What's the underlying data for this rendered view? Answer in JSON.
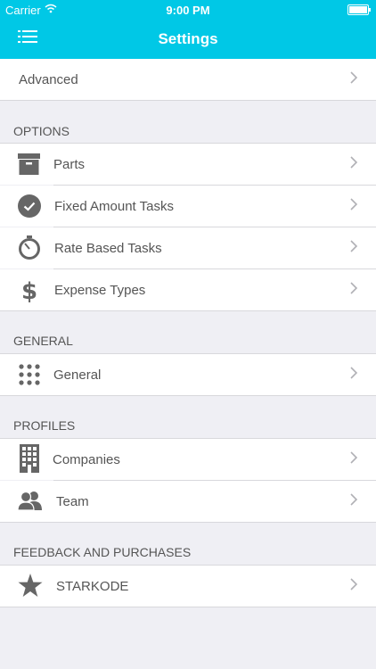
{
  "status_bar": {
    "carrier": "Carrier",
    "time": "9:00 PM"
  },
  "nav": {
    "title": "Settings"
  },
  "advanced": {
    "label": "Advanced"
  },
  "sections": {
    "options": {
      "header": "OPTIONS",
      "items": [
        {
          "label": "Parts",
          "icon": "archive-box-icon"
        },
        {
          "label": "Fixed Amount Tasks",
          "icon": "checkmark-circle-icon"
        },
        {
          "label": "Rate Based Tasks",
          "icon": "stopwatch-icon"
        },
        {
          "label": "Expense Types",
          "icon": "dollar-sign-icon"
        }
      ]
    },
    "general": {
      "header": "GENERAL",
      "items": [
        {
          "label": "General",
          "icon": "dots-grid-icon"
        }
      ]
    },
    "profiles": {
      "header": "PROFILES",
      "items": [
        {
          "label": "Companies",
          "icon": "building-icon"
        },
        {
          "label": "Team",
          "icon": "people-icon"
        }
      ]
    },
    "feedback": {
      "header": "FEEDBACK AND PURCHASES",
      "items": [
        {
          "label": "STARKODE",
          "icon": "star-icon"
        }
      ]
    }
  },
  "colors": {
    "accent": "#00c8e6",
    "icon": "#666666",
    "background": "#efeff4"
  }
}
